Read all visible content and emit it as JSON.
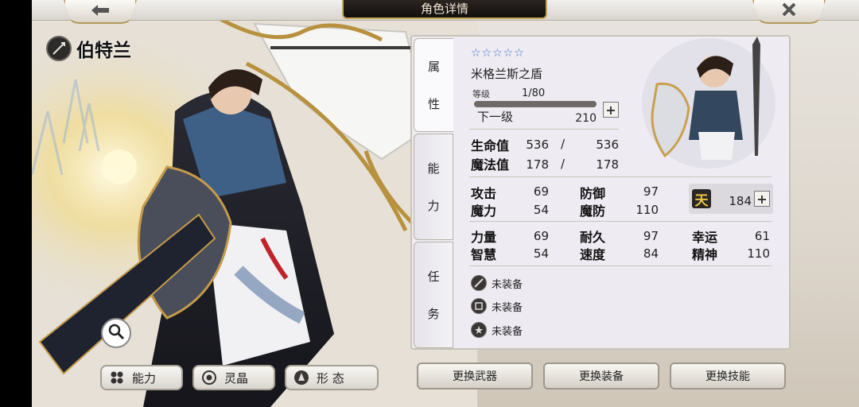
{
  "header": {
    "title": "角色详情",
    "back_icon": "arrow-left-icon",
    "close_icon": "close-icon"
  },
  "character": {
    "name": "伯特兰",
    "role_icon": "spear-icon"
  },
  "side_tabs": [
    {
      "id": "attributes",
      "chars": [
        "属",
        "性"
      ]
    },
    {
      "id": "ability",
      "chars": [
        "能",
        "力"
      ]
    },
    {
      "id": "mission",
      "chars": [
        "任",
        "务"
      ]
    }
  ],
  "equipment_header": {
    "stars": "☆☆☆☆☆",
    "item_name": "米格兰斯之盾",
    "level_label": "等级",
    "level_value": "1/80",
    "level_progress": 0.0,
    "next_label": "下一级",
    "next_value": "210"
  },
  "vitals": [
    {
      "label": "生命值",
      "current": "536",
      "sep": "/",
      "max": "536"
    },
    {
      "label": "魔法值",
      "current": "178",
      "sep": "/",
      "max": "178"
    }
  ],
  "stats_a": [
    {
      "label": "攻击",
      "value": "69"
    },
    {
      "label": "防御",
      "value": "97"
    },
    {
      "label": "魔力",
      "value": "54"
    },
    {
      "label": "魔防",
      "value": "110"
    }
  ],
  "sky": {
    "badge": "天",
    "value": "184"
  },
  "stats_b": [
    {
      "label": "力量",
      "value": "69"
    },
    {
      "label": "耐久",
      "value": "97"
    },
    {
      "label": "幸运",
      "value": "61"
    },
    {
      "label": "智慧",
      "value": "54"
    },
    {
      "label": "速度",
      "value": "84"
    },
    {
      "label": "精神",
      "value": "110"
    }
  ],
  "equipment_slots": [
    {
      "icon": "weapon-slot-icon",
      "label": "未装备"
    },
    {
      "icon": "armor-slot-icon",
      "label": "未装备"
    },
    {
      "icon": "accessory-slot-icon",
      "label": "未装备"
    }
  ],
  "bottom_tabs": [
    {
      "icon": "ability-icon",
      "label": "能力"
    },
    {
      "icon": "crystal-icon",
      "label": "灵晶"
    },
    {
      "icon": "form-icon",
      "label": "形 态"
    }
  ],
  "actions": [
    {
      "label": "更换武器"
    },
    {
      "label": "更换装备"
    },
    {
      "label": "更换技能"
    }
  ],
  "colors": {
    "panel_bg": "#eeecf3",
    "title_plate": "#1a1512",
    "gold_border": "#c6a55a",
    "star_blue": "#4a6fc9",
    "sky_gold": "#e8c24a"
  }
}
